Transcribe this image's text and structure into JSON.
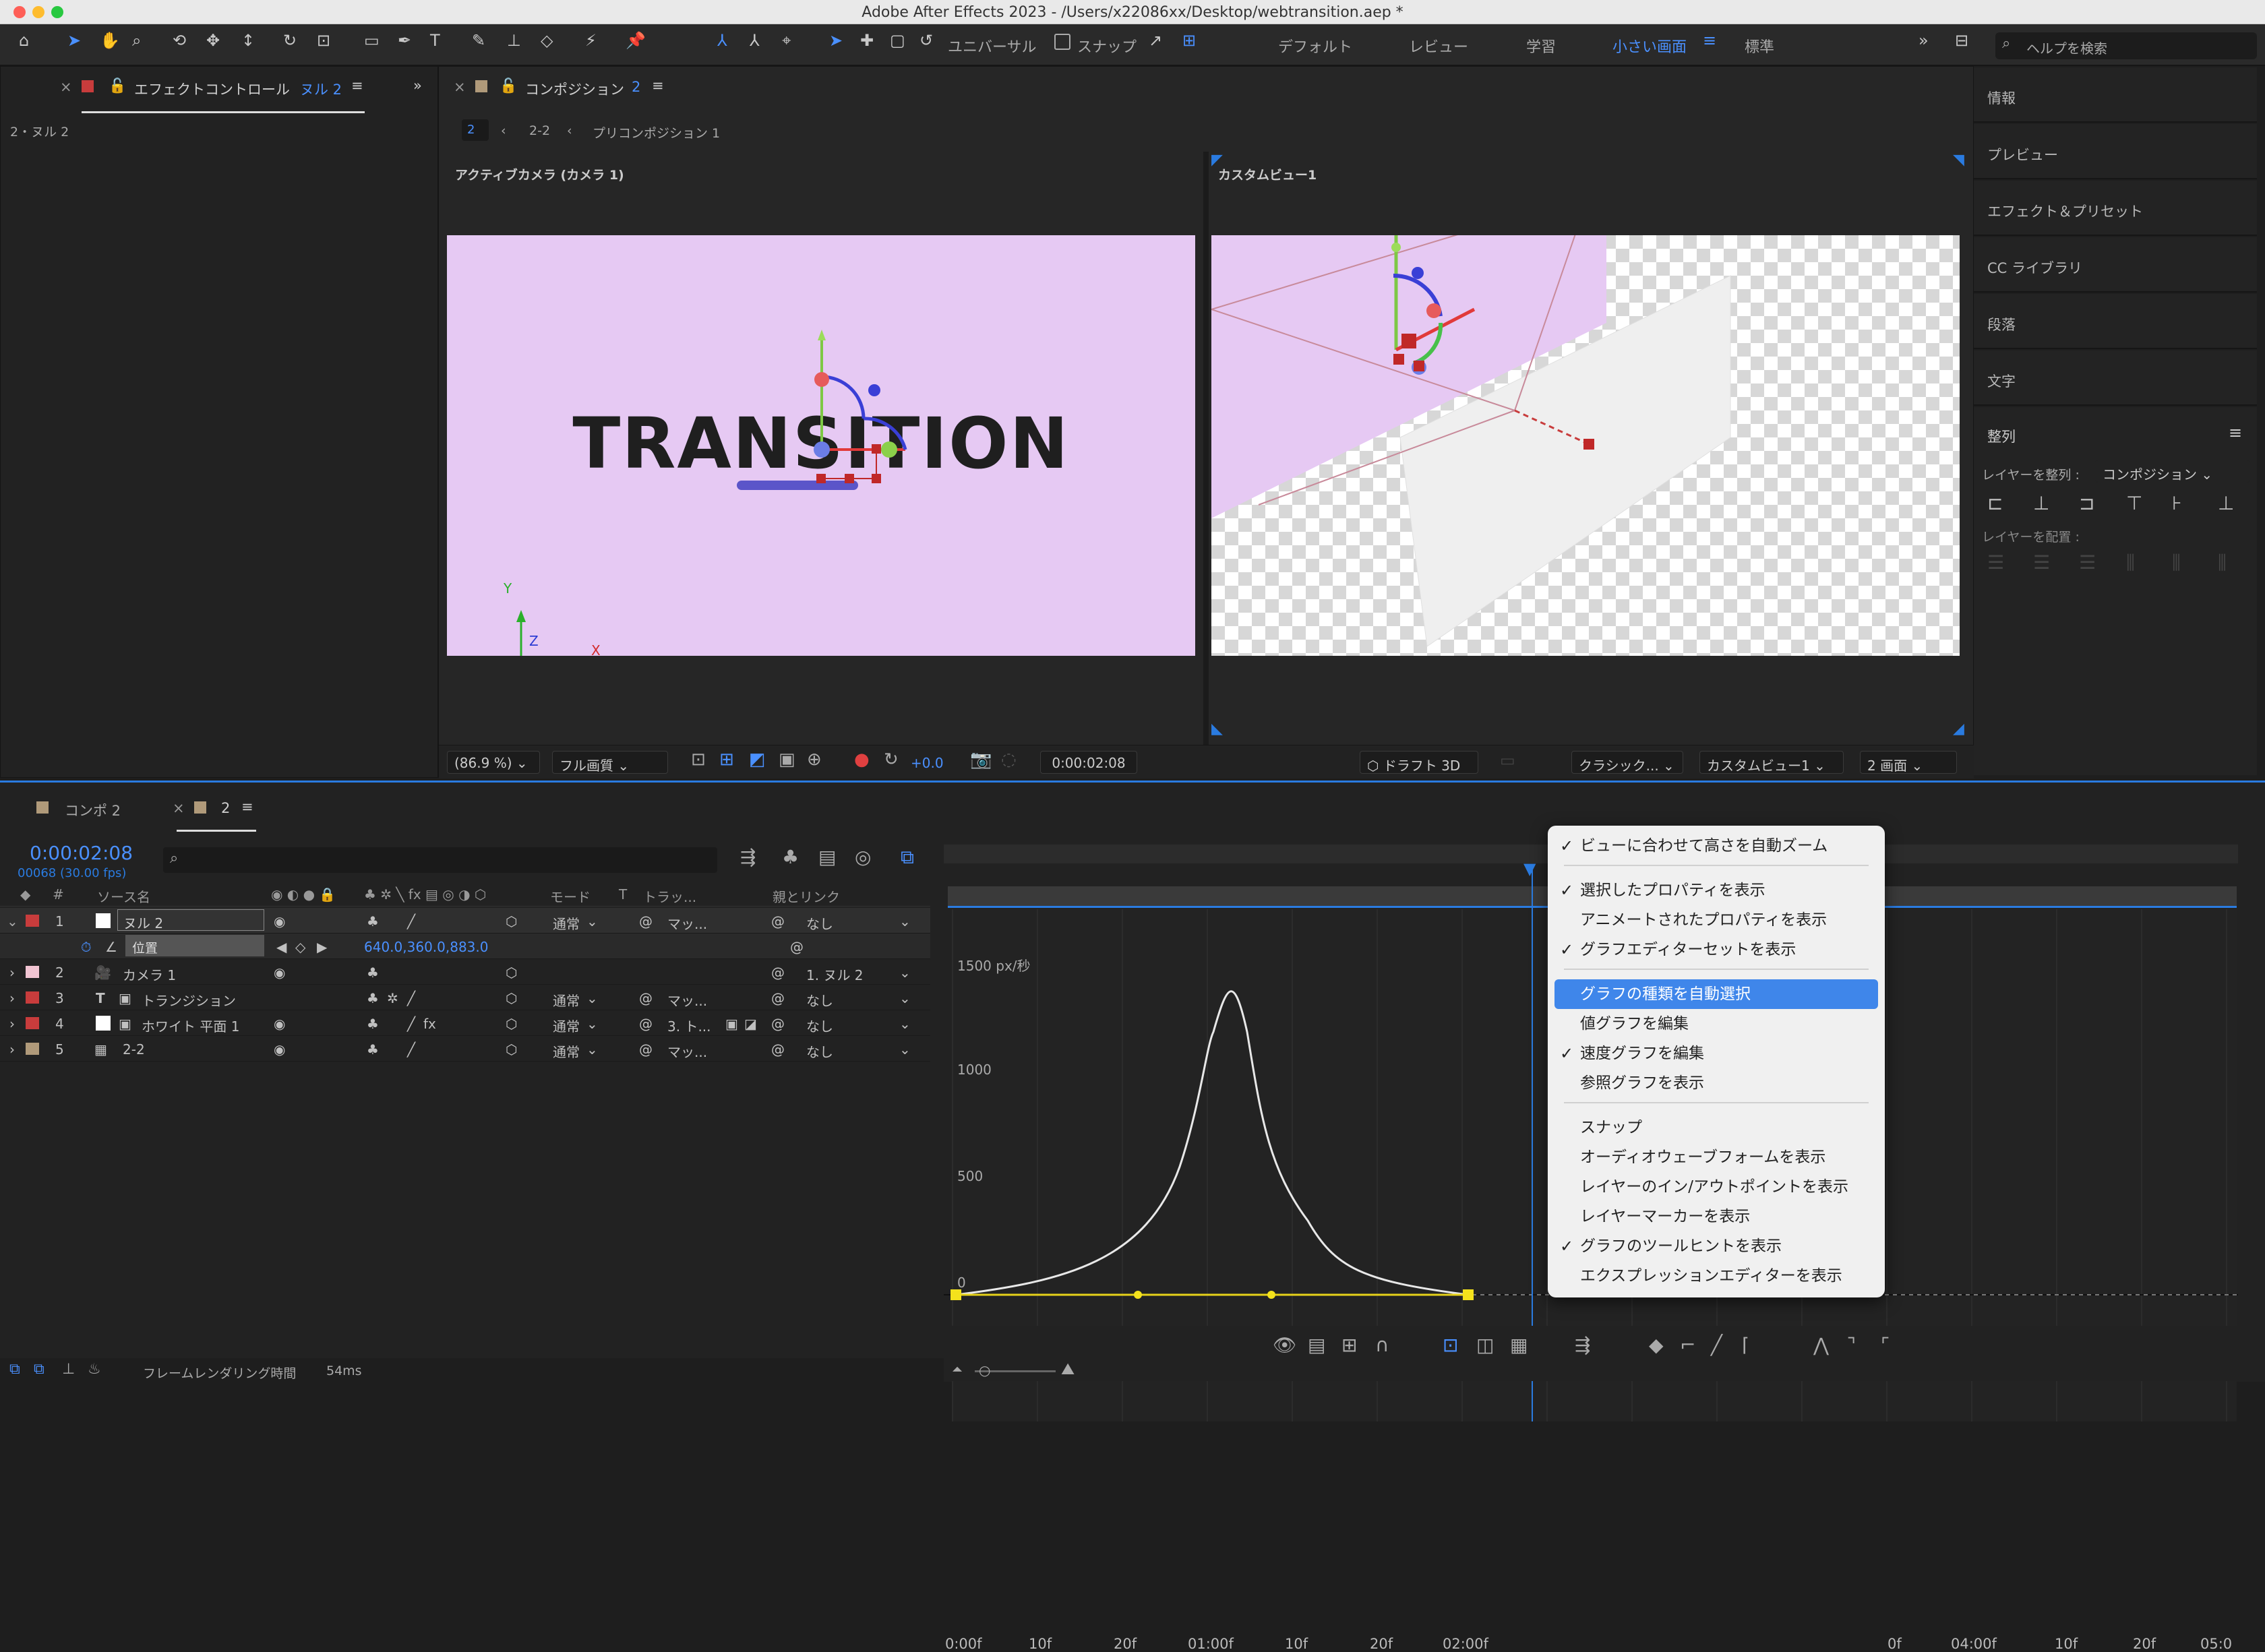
{
  "window": {
    "title": "Adobe After Effects 2023 - /Users/x22086xx/Desktop/webtransition.aep *"
  },
  "toolbar": {
    "universal": "ユニバーサル",
    "snap": "スナップ",
    "workspaces": [
      "デフォルト",
      "レビュー",
      "学習",
      "小さい画面",
      "標準"
    ],
    "active_workspace": "小さい画面",
    "help_placeholder": "ヘルプを検索"
  },
  "effects_panel": {
    "tab_label": "エフェクトコントロール",
    "tab_target": "ヌル 2",
    "breadcrumb": "2・ヌル 2"
  },
  "comp_panel": {
    "tab_label": "コンポジション",
    "tab_target": "2",
    "nav": [
      "2",
      "2-2",
      "プリコンポジション 1"
    ],
    "view_left_label": "アクティブカメラ (カメラ 1)",
    "view_right_label": "カスタムビュー1",
    "canvas_text": "TRANSITION",
    "axis_labels": {
      "y": "Y",
      "z": "Z",
      "x": "X"
    },
    "footer": {
      "zoom": "(86.9 %)",
      "quality": "フル画質",
      "exposure": "+0.0",
      "timecode": "0:00:02:08",
      "renderer": "ドラフト 3D",
      "layout": "クラシック...",
      "view": "カスタムビュー1",
      "screens": "2 画面"
    }
  },
  "right_panel": {
    "items": [
      "情報",
      "プレビュー",
      "エフェクト＆プリセット",
      "CC ライブラリ",
      "段落",
      "文字"
    ],
    "align": {
      "title": "整列",
      "align_to_label": "レイヤーを整列 :",
      "align_to_value": "コンポジション",
      "distribute_label": "レイヤーを配置 :"
    }
  },
  "timeline": {
    "tabs": [
      "コンポ 2",
      "2"
    ],
    "timecode": "0:00:02:08",
    "frame_info": "00068 (30.00 fps)",
    "columns": {
      "source": "ソース名",
      "mode": "モード",
      "t": "T",
      "track": "トラッ...",
      "parent": "親とリンク"
    },
    "layers": [
      {
        "num": "1",
        "name": "ヌル 2",
        "color": "#c83c3c",
        "mode": "通常",
        "track": "マッ...",
        "parent": "なし"
      },
      {
        "num": "2",
        "name": "カメラ 1",
        "color": "#f2c5d3",
        "mode": "",
        "track": "",
        "parent": "1. ヌル 2"
      },
      {
        "num": "3",
        "name": "トランジション",
        "color": "#c83c3c",
        "mode": "通常",
        "track": "マッ...",
        "parent": "なし"
      },
      {
        "num": "4",
        "name": "ホワイト 平面 1",
        "color": "#c83c3c",
        "mode": "通常",
        "track": "3. ト...",
        "parent": "なし"
      },
      {
        "num": "5",
        "name": "2-2",
        "color": "#b09a7a",
        "mode": "通常",
        "track": "マッ...",
        "parent": "なし"
      }
    ],
    "property": {
      "name": "位置",
      "value": "640.0,360.0,883.0"
    },
    "ruler": [
      "0:00f",
      "10f",
      "20f",
      "01:00f",
      "10f",
      "20f",
      "02:00f",
      "0f",
      "04:00f",
      "10f",
      "20f",
      "05:0"
    ],
    "graph_y_labels": [
      "1500 px/秒",
      "1000",
      "500",
      "0"
    ],
    "status": {
      "label": "フレームレンダリング時間",
      "value": "54ms"
    }
  },
  "context_menu": {
    "items": [
      {
        "label": "ビューに合わせて高さを自動ズーム",
        "checked": true
      },
      {
        "label": "選択したプロパティを表示",
        "checked": true
      },
      {
        "label": "アニメートされたプロパティを表示",
        "checked": false
      },
      {
        "label": "グラフエディターセットを表示",
        "checked": true
      },
      {
        "label": "グラフの種類を自動選択",
        "checked": false,
        "highlighted": true
      },
      {
        "label": "値グラフを編集",
        "checked": false
      },
      {
        "label": "速度グラフを編集",
        "checked": true
      },
      {
        "label": "参照グラフを表示",
        "checked": false
      },
      {
        "label": "スナップ",
        "checked": false
      },
      {
        "label": "オーディオウェーブフォームを表示",
        "checked": false
      },
      {
        "label": "レイヤーのイン/アウトポイントを表示",
        "checked": false
      },
      {
        "label": "レイヤーマーカーを表示",
        "checked": false
      },
      {
        "label": "グラフのツールヒントを表示",
        "checked": true
      },
      {
        "label": "エクスプレッションエディターを表示",
        "checked": false
      }
    ],
    "checkmark": "✓"
  }
}
